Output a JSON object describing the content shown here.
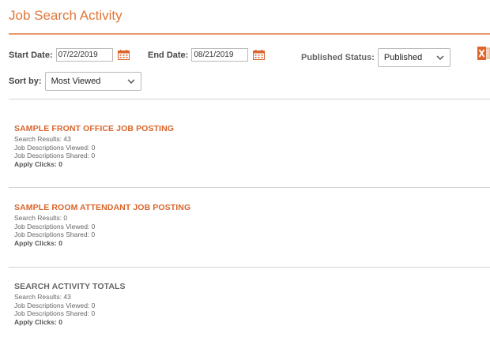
{
  "header": {
    "title": "Job Search Activity"
  },
  "filters": {
    "start_date_label": "Start Date:",
    "start_date_value": "07/22/2019",
    "end_date_label": "End Date:",
    "end_date_value": "08/21/2019",
    "published_status_label": "Published Status:",
    "published_status_value": "Published",
    "sort_by_label": "Sort by:",
    "sort_by_value": "Most Viewed"
  },
  "colors": {
    "accent": "#e0773a",
    "job_title": "#d9652b",
    "muted": "#666666"
  },
  "icons": {
    "calendar": "calendar-icon",
    "excel": "excel-export-icon",
    "dropdown": "chevron-down-icon"
  },
  "jobs": [
    {
      "title": "SAMPLE FRONT OFFICE JOB POSTING",
      "search_results": "Search Results: 43",
      "descriptions_viewed": "Job Descriptions Viewed: 0",
      "descriptions_shared": "Job Descriptions Shared: 0",
      "apply_clicks": "Apply Clicks: 0"
    },
    {
      "title": "SAMPLE ROOM ATTENDANT JOB POSTING",
      "search_results": "Search Results: 0",
      "descriptions_viewed": "Job Descriptions Viewed: 0",
      "descriptions_shared": "Job Descriptions Shared: 0",
      "apply_clicks": "Apply Clicks: 0"
    }
  ],
  "totals": {
    "title": "SEARCH ACTIVITY TOTALS",
    "search_results": "Search Results: 43",
    "descriptions_viewed": "Job Descriptions Viewed: 0",
    "descriptions_shared": "Job Descriptions Shared: 0",
    "apply_clicks": "Apply Clicks: 0"
  }
}
